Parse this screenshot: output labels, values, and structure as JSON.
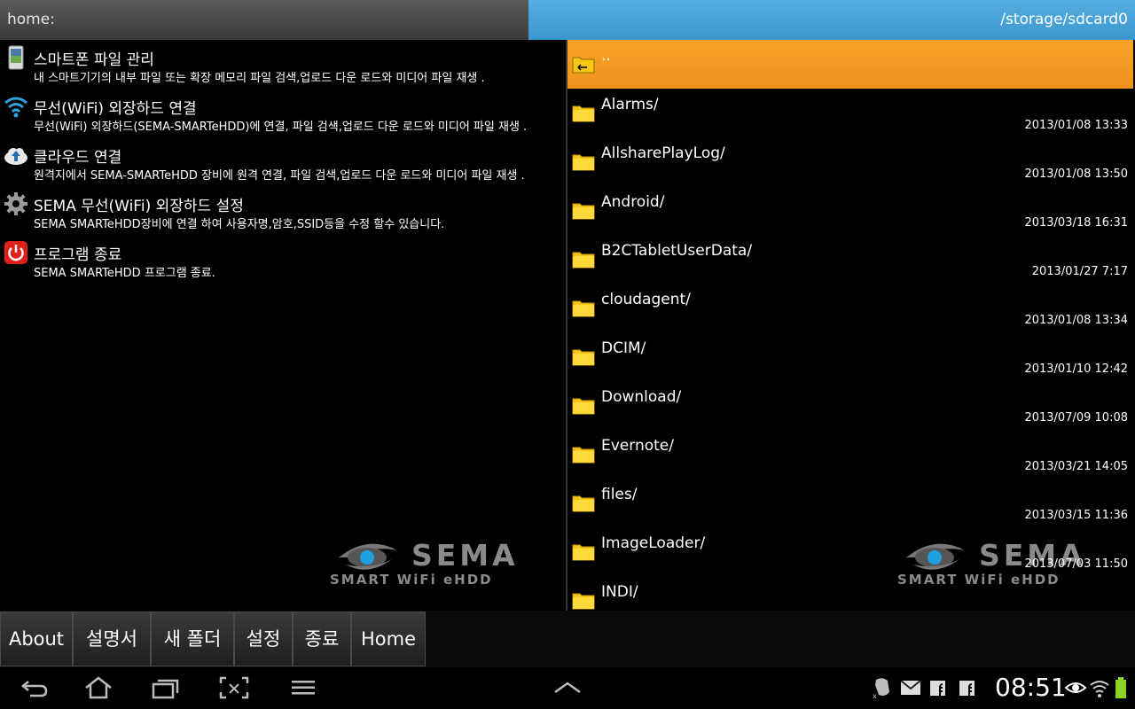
{
  "header": {
    "left_path": "home:",
    "right_path": "/storage/sdcard0"
  },
  "menu": [
    {
      "icon": "smartphone-icon",
      "title": "스마트폰 파일 관리",
      "desc": "내 스마트기기의 내부 파일 또는 확장 메모리 파일 검색,업로드 다운 로드와 미디어 파일 재생 ."
    },
    {
      "icon": "wifi-icon",
      "title": "무선(WiFi) 외장하드 연결",
      "desc": "무선(WiFi) 외장하드(SEMA-SMARTeHDD)에 연결, 파일 검색,업로드 다운 로드와 미디어 파일 재생 ."
    },
    {
      "icon": "cloud-icon",
      "title": "클라우드 연결",
      "desc": "원격지에서 SEMA-SMARTeHDD 장비에 원격 연결, 파일 검색,업로드 다운 로드와 미디어 파일 재생 ."
    },
    {
      "icon": "gear-icon",
      "title": "SEMA 무선(WiFi) 외장하드 설정",
      "desc": "SEMA SMARTeHDD장비에 연결 하여 사용자명,암호,SSID등을 수정 할수 있습니다."
    },
    {
      "icon": "power-icon",
      "title": "프로그램 종료",
      "desc": "SEMA SMARTeHDD 프로그램 종료."
    }
  ],
  "logo": {
    "word": "SEMA",
    "sub": "SMART WiFi eHDD"
  },
  "files": [
    {
      "name": "..",
      "date": ""
    },
    {
      "name": "Alarms/",
      "date": "2013/01/08 13:33"
    },
    {
      "name": "AllsharePlayLog/",
      "date": "2013/01/08 13:50"
    },
    {
      "name": "Android/",
      "date": "2013/03/18 16:31"
    },
    {
      "name": "B2CTabletUserData/",
      "date": "2013/01/27 7:17"
    },
    {
      "name": "cloudagent/",
      "date": "2013/01/08 13:34"
    },
    {
      "name": "DCIM/",
      "date": "2013/01/10 12:42"
    },
    {
      "name": "Download/",
      "date": "2013/07/09 10:08"
    },
    {
      "name": "Evernote/",
      "date": "2013/03/21 14:05"
    },
    {
      "name": "files/",
      "date": "2013/03/15 11:36"
    },
    {
      "name": "ImageLoader/",
      "date": "2013/07/03 11:50"
    },
    {
      "name": "INDI/",
      "date": ""
    }
  ],
  "buttons": [
    "About",
    "설명서",
    "새 폴더",
    "설정",
    "종료",
    "Home"
  ],
  "status": {
    "time": "08:51"
  },
  "colors": {
    "accent": "#3b97cf",
    "highlight": "#f39a22",
    "folder": "#f5c518"
  }
}
